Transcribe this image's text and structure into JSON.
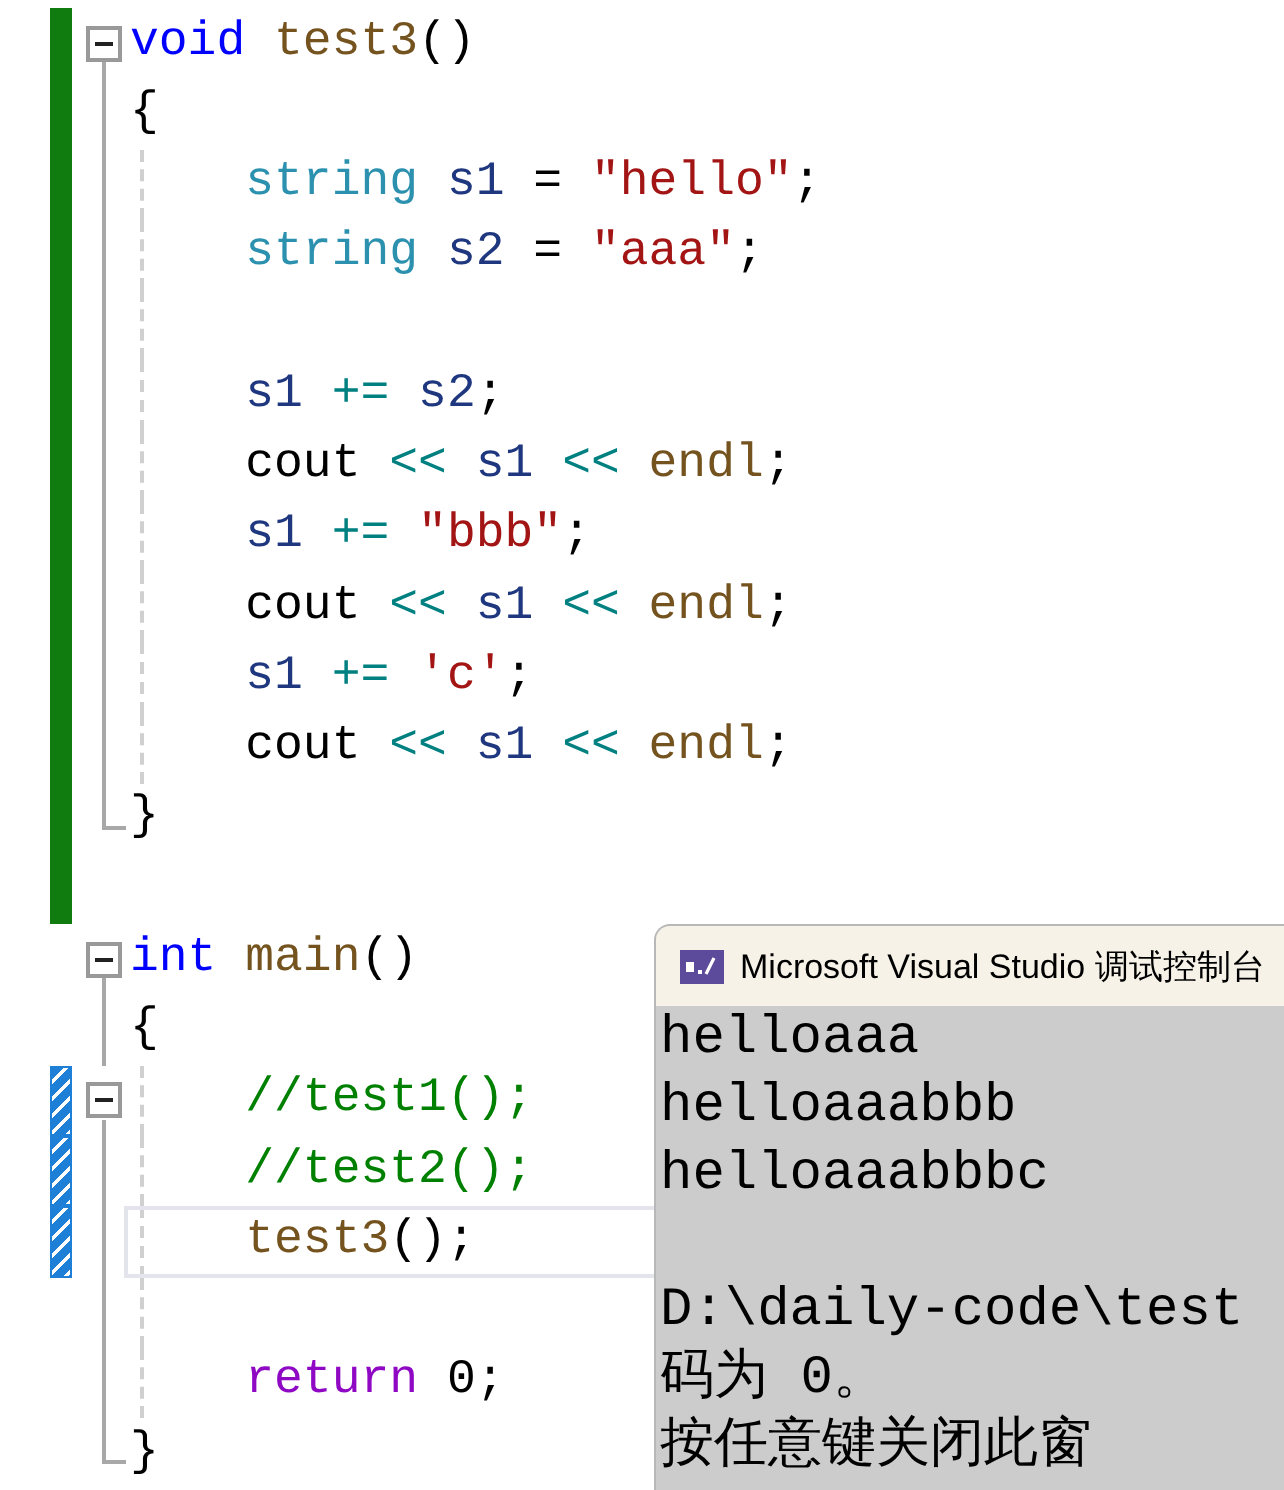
{
  "editor": {
    "lines": [
      {
        "changed": true,
        "saved": true,
        "kind": "start",
        "guide": false,
        "current": false,
        "tokens": [
          {
            "text": "void ",
            "kind": "keyword"
          },
          {
            "text": "test3",
            "kind": "function"
          },
          {
            "text": "()",
            "kind": "plain"
          }
        ]
      },
      {
        "changed": true,
        "saved": true,
        "kind": "inside",
        "guide": false,
        "current": false,
        "tokens": [
          {
            "text": "{",
            "kind": "plain"
          }
        ]
      },
      {
        "changed": true,
        "saved": true,
        "kind": "inside",
        "guide": true,
        "current": false,
        "tokens": [
          {
            "text": "    string ",
            "kind": "type"
          },
          {
            "text": "s1 ",
            "kind": "variable"
          },
          {
            "text": "= ",
            "kind": "plain"
          },
          {
            "text": "\"hello\"",
            "kind": "string"
          },
          {
            "text": ";",
            "kind": "plain"
          }
        ]
      },
      {
        "changed": true,
        "saved": true,
        "kind": "inside",
        "guide": true,
        "current": false,
        "tokens": [
          {
            "text": "    string ",
            "kind": "type"
          },
          {
            "text": "s2 ",
            "kind": "variable"
          },
          {
            "text": "= ",
            "kind": "plain"
          },
          {
            "text": "\"aaa\"",
            "kind": "string"
          },
          {
            "text": ";",
            "kind": "plain"
          }
        ]
      },
      {
        "changed": true,
        "saved": true,
        "kind": "inside",
        "guide": true,
        "current": false
      },
      {
        "changed": true,
        "saved": true,
        "kind": "inside",
        "guide": true,
        "current": false,
        "tokens": [
          {
            "text": "    s1 ",
            "kind": "variable"
          },
          {
            "text": "+= ",
            "kind": "operator"
          },
          {
            "text": "s2",
            "kind": "variable"
          },
          {
            "text": ";",
            "kind": "plain"
          }
        ]
      },
      {
        "changed": true,
        "saved": true,
        "kind": "inside",
        "guide": true,
        "current": false,
        "tokens": [
          {
            "text": "    cout ",
            "kind": "plain"
          },
          {
            "text": "<< ",
            "kind": "operator"
          },
          {
            "text": "s1 ",
            "kind": "variable"
          },
          {
            "text": "<< ",
            "kind": "operator"
          },
          {
            "text": "endl",
            "kind": "function"
          },
          {
            "text": ";",
            "kind": "plain"
          }
        ]
      },
      {
        "changed": true,
        "saved": true,
        "kind": "inside",
        "guide": true,
        "current": false,
        "tokens": [
          {
            "text": "    s1 ",
            "kind": "variable"
          },
          {
            "text": "+= ",
            "kind": "operator"
          },
          {
            "text": "\"bbb\"",
            "kind": "string"
          },
          {
            "text": ";",
            "kind": "plain"
          }
        ]
      },
      {
        "changed": true,
        "saved": true,
        "kind": "inside",
        "guide": true,
        "current": false,
        "tokens": [
          {
            "text": "    cout ",
            "kind": "plain"
          },
          {
            "text": "<< ",
            "kind": "operator"
          },
          {
            "text": "s1 ",
            "kind": "variable"
          },
          {
            "text": "<< ",
            "kind": "operator"
          },
          {
            "text": "endl",
            "kind": "function"
          },
          {
            "text": ";",
            "kind": "plain"
          }
        ]
      },
      {
        "changed": true,
        "saved": true,
        "kind": "inside",
        "guide": true,
        "current": false,
        "tokens": [
          {
            "text": "    s1 ",
            "kind": "variable"
          },
          {
            "text": "+= ",
            "kind": "operator"
          },
          {
            "text": "'c'",
            "kind": "string"
          },
          {
            "text": ";",
            "kind": "plain"
          }
        ]
      },
      {
        "changed": true,
        "saved": true,
        "kind": "inside",
        "guide": true,
        "current": false,
        "tokens": [
          {
            "text": "    cout ",
            "kind": "plain"
          },
          {
            "text": "<< ",
            "kind": "operator"
          },
          {
            "text": "s1 ",
            "kind": "variable"
          },
          {
            "text": "<< ",
            "kind": "operator"
          },
          {
            "text": "endl",
            "kind": "function"
          },
          {
            "text": ";",
            "kind": "plain"
          }
        ]
      },
      {
        "changed": true,
        "saved": true,
        "kind": "end",
        "guide": false,
        "current": false,
        "tokens": [
          {
            "text": "}",
            "kind": "plain"
          }
        ]
      },
      {
        "changed": true,
        "saved": true,
        "kind": "none",
        "guide": false,
        "current": false
      },
      {
        "changed": false,
        "kind": "start",
        "guide": false,
        "current": false,
        "tokens": [
          {
            "text": "int ",
            "kind": "keyword"
          },
          {
            "text": "main",
            "kind": "function"
          },
          {
            "text": "()",
            "kind": "plain"
          }
        ]
      },
      {
        "changed": false,
        "kind": "inside",
        "guide": false,
        "current": false,
        "tokens": [
          {
            "text": "{",
            "kind": "plain"
          }
        ]
      },
      {
        "changed": true,
        "saved": false,
        "kind": "start",
        "guide": true,
        "current": false,
        "tokens": [
          {
            "text": "    //test1();",
            "kind": "comment"
          }
        ]
      },
      {
        "changed": true,
        "saved": false,
        "kind": "inside",
        "guide": true,
        "current": false,
        "tokens": [
          {
            "text": "    //test2();",
            "kind": "comment"
          }
        ]
      },
      {
        "changed": true,
        "saved": false,
        "kind": "inside",
        "guide": true,
        "current": true,
        "tokens": [
          {
            "text": "    test3",
            "kind": "function"
          },
          {
            "text": "();",
            "kind": "plain"
          }
        ]
      },
      {
        "changed": false,
        "kind": "inside",
        "guide": true,
        "current": false
      },
      {
        "changed": false,
        "kind": "inside",
        "guide": true,
        "current": false,
        "tokens": [
          {
            "text": "    return ",
            "kind": "control"
          },
          {
            "text": "0;",
            "kind": "plain"
          }
        ]
      },
      {
        "changed": false,
        "kind": "end",
        "guide": false,
        "current": false,
        "tokens": [
          {
            "text": "}",
            "kind": "plain"
          }
        ]
      }
    ]
  },
  "console": {
    "title": "Microsoft Visual Studio 调试控制台",
    "lines": [
      "helloaaa",
      "helloaaabbb",
      "helloaaabbbc",
      "D:\\daily-code\\test",
      "码为 0。",
      "按任意键关闭此窗"
    ]
  }
}
